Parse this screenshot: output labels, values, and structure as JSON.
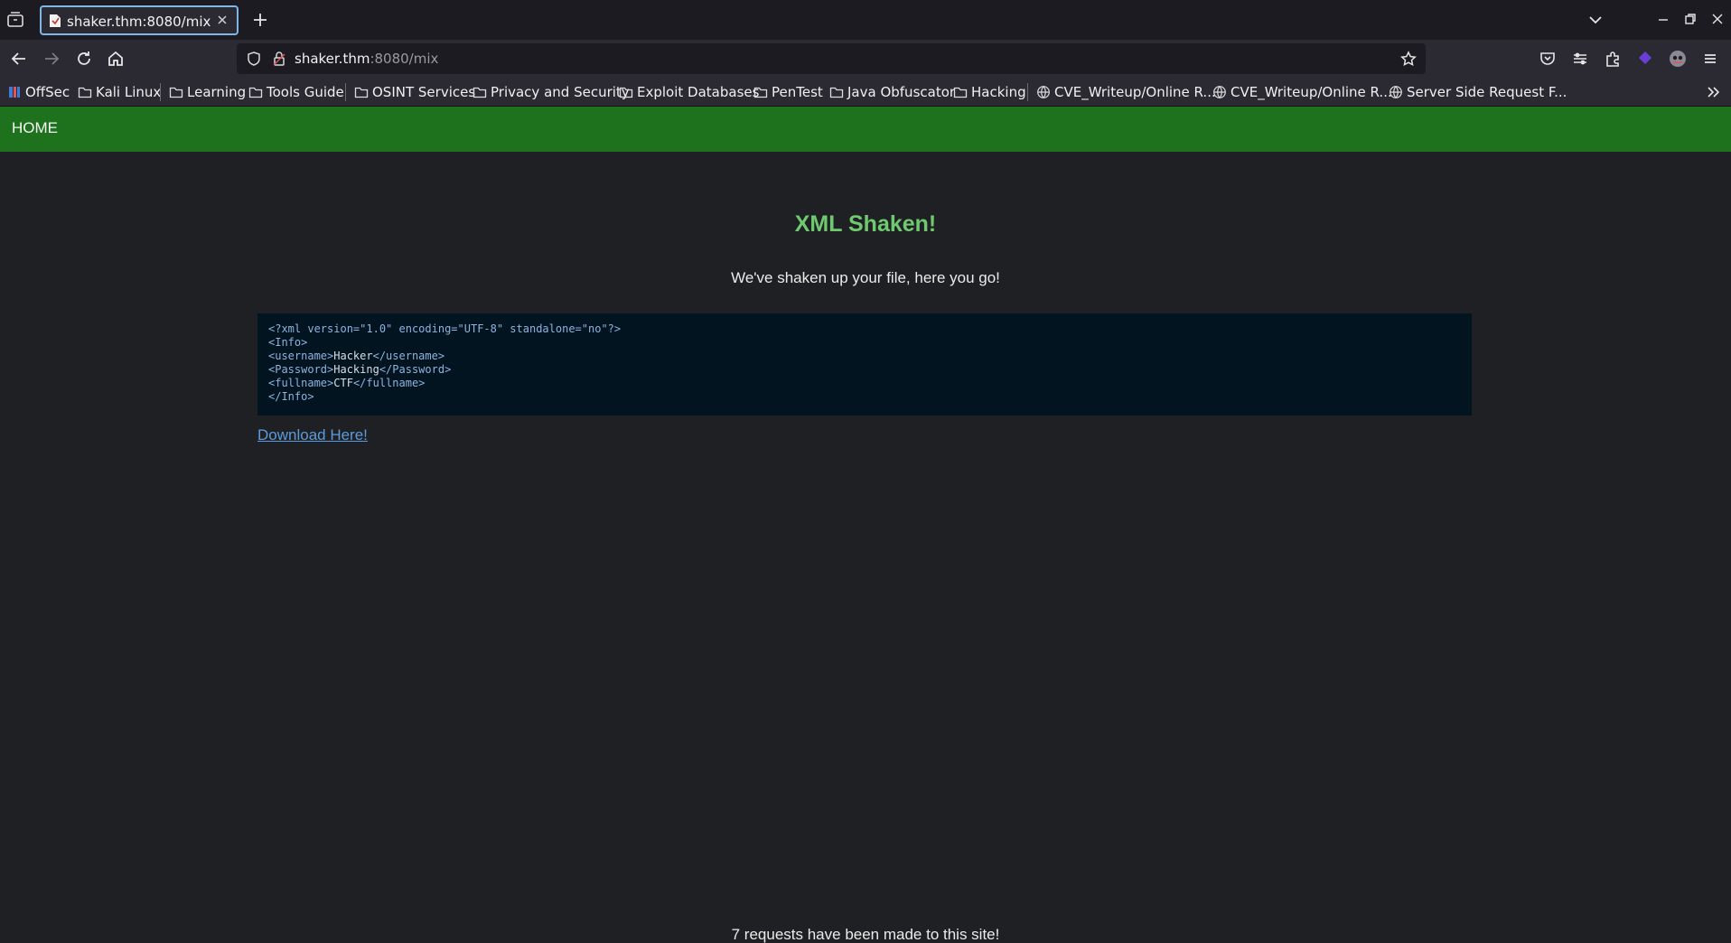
{
  "browser": {
    "tab": {
      "title": "shaker.thm:8080/mix"
    },
    "url": {
      "host": "shaker.thm",
      "rest": ":8080/mix"
    },
    "bookmarks": [
      {
        "label": "OffSec",
        "icon": "offsec-icon"
      },
      {
        "label": "Kali Linux",
        "icon": "folder-icon"
      },
      {
        "label": "Learning",
        "icon": "folder-icon"
      },
      {
        "label": "Tools Guide",
        "icon": "folder-icon"
      },
      {
        "label": "OSINT Services",
        "icon": "folder-icon"
      },
      {
        "label": "Privacy and Security",
        "icon": "folder-icon"
      },
      {
        "label": "Exploit Databases",
        "icon": "folder-icon"
      },
      {
        "label": "PenTest",
        "icon": "folder-icon"
      },
      {
        "label": "Java Obfuscator",
        "icon": "folder-icon"
      },
      {
        "label": "Hacking",
        "icon": "folder-icon"
      },
      {
        "label": "CVE_Writeup/Online R...",
        "icon": "globe-icon"
      },
      {
        "label": "CVE_Writeup/Online R...",
        "icon": "globe-icon"
      },
      {
        "label": "Server Side Request F...",
        "icon": "globe-icon"
      }
    ]
  },
  "site": {
    "nav": {
      "home": "HOME"
    },
    "title": "XML Shaken!",
    "subtitle": "We've shaken up your file, here you go!",
    "code": {
      "line1": {
        "tag": "<?xml version=\"1.0\" encoding=\"UTF-8\" standalone=\"no\"?>"
      },
      "line2": {
        "tag": "<Info>"
      },
      "line3": {
        "open": "<username>",
        "text": "Hacker",
        "close": "</username>"
      },
      "line4": {
        "open": "<Password>",
        "text": "Hacking",
        "close": "</Password>"
      },
      "line5": {
        "open": "<fullname>",
        "text": "CTF",
        "close": "</fullname>"
      },
      "line6": {
        "tag": "</Info>"
      }
    },
    "download_label": "Download Here!",
    "footer": "7 requests have been made to this site!"
  },
  "colors": {
    "nav_green": "#1e721e",
    "title_green": "#6fca6f",
    "code_bg": "#011420",
    "link_blue": "#5b9bdd",
    "page_bg": "#1f2023"
  }
}
